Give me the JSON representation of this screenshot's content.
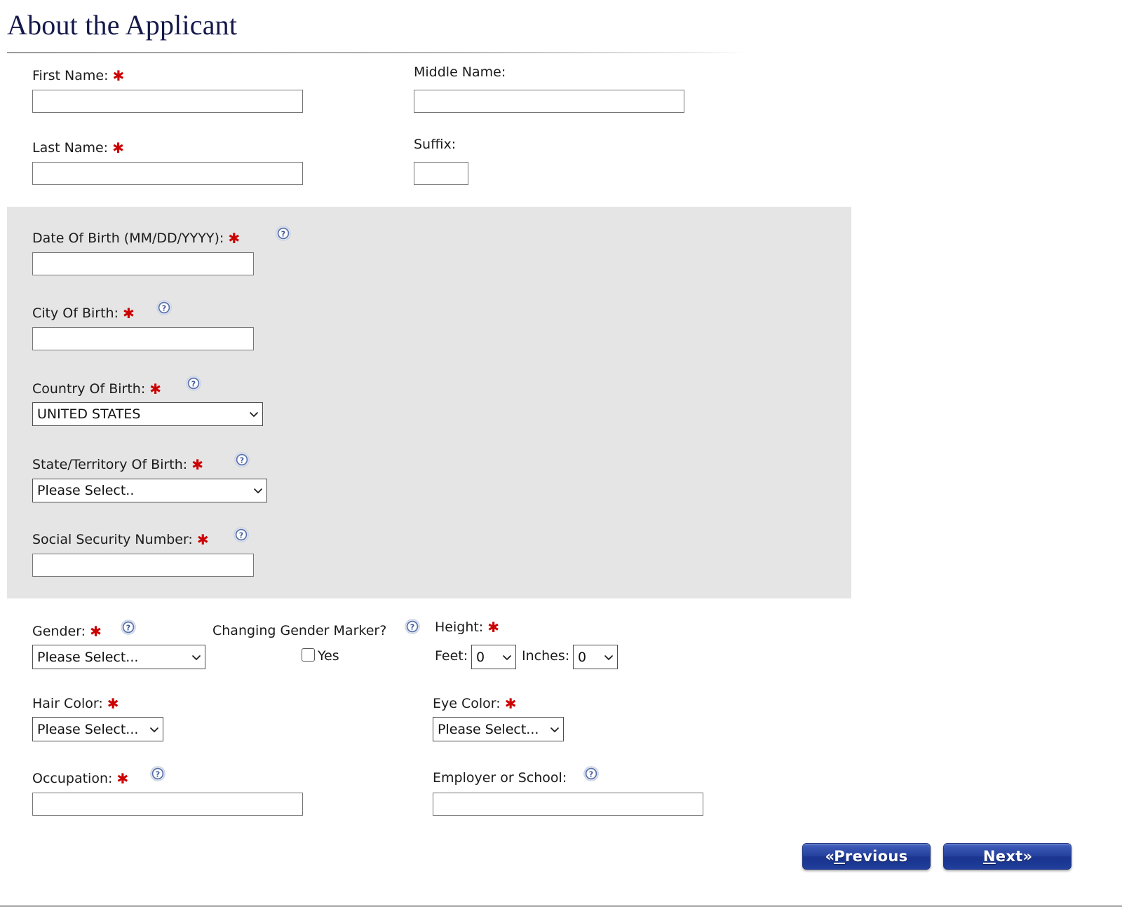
{
  "page": {
    "title": "About the Applicant"
  },
  "fields": {
    "first_name": {
      "label": "First Name:",
      "required": true,
      "value": "",
      "placeholder": ""
    },
    "middle_name": {
      "label": "Middle Name:",
      "required": false,
      "value": "",
      "placeholder": ""
    },
    "last_name": {
      "label": "Last Name:",
      "required": true,
      "value": "",
      "placeholder": ""
    },
    "suffix": {
      "label": "Suffix:",
      "required": false,
      "value": "",
      "placeholder": ""
    },
    "date_of_birth": {
      "label": "Date Of Birth (MM/DD/YYYY):",
      "required": true,
      "value": "",
      "placeholder": "",
      "help": true
    },
    "city_of_birth": {
      "label": "City Of Birth:",
      "required": true,
      "value": "",
      "placeholder": "",
      "help": true
    },
    "country_of_birth": {
      "label": "Country Of Birth:",
      "required": true,
      "value": "UNITED STATES",
      "help": true
    },
    "state_of_birth": {
      "label": "State/Territory Of Birth:",
      "required": true,
      "value": "Please Select..",
      "help": true
    },
    "ssn": {
      "label": "Social Security Number:",
      "required": true,
      "value": "",
      "placeholder": "",
      "help": true
    },
    "gender": {
      "label": "Gender:",
      "required": true,
      "value": "Please Select...",
      "help": true
    },
    "changing_gender_marker": {
      "label": "Changing Gender Marker?",
      "checkbox_label": "Yes",
      "checked": false,
      "help": true
    },
    "height": {
      "label": "Height:",
      "required": true,
      "feet_label": "Feet:",
      "feet_value": "0",
      "inches_label": "Inches:",
      "inches_value": "0"
    },
    "hair_color": {
      "label": "Hair Color:",
      "required": true,
      "value": "Please Select..."
    },
    "eye_color": {
      "label": "Eye Color:",
      "required": true,
      "value": "Please Select..."
    },
    "occupation": {
      "label": "Occupation:",
      "required": true,
      "value": "",
      "placeholder": "",
      "help": true
    },
    "employer_or_school": {
      "label": "Employer or School:",
      "required": false,
      "value": "",
      "placeholder": "",
      "help": true
    }
  },
  "nav": {
    "previous_prefix": "« ",
    "previous_accesskey": "P",
    "previous_rest": "revious",
    "next_accesskey": "N",
    "next_rest": "ext",
    "next_suffix": " »"
  },
  "icons": {
    "help": "help-question-icon",
    "caret": "chevron-down-icon",
    "required": "required-asterisk"
  },
  "colors": {
    "title": "#14184a",
    "required_asterisk": "#cc0000",
    "panel_background": "#e5e5e5",
    "button_blue": "#26429f",
    "help_icon_blue": "#5a73ae"
  }
}
